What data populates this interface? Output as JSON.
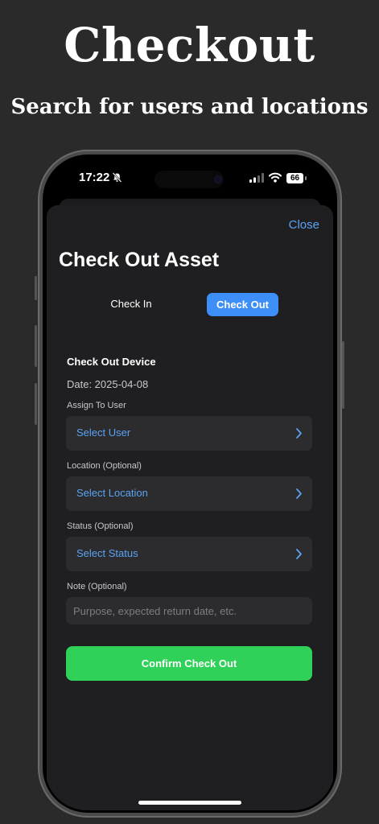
{
  "promo": {
    "title": "Checkout",
    "subtitle": "Search for users and locations"
  },
  "status_bar": {
    "time": "17:22",
    "battery": "66",
    "icons": [
      "bell-slash-icon",
      "signal-icon",
      "wifi-icon",
      "battery-icon"
    ]
  },
  "sheet": {
    "close_label": "Close",
    "title": "Check Out Asset",
    "tabs": [
      {
        "label": "Check In",
        "selected": false
      },
      {
        "label": "Check Out",
        "selected": true
      }
    ]
  },
  "form": {
    "section_title": "Check Out Device",
    "date_text": "Date: 2025-04-08",
    "fields": [
      {
        "label": "Assign To User",
        "value": "Select User"
      },
      {
        "label": "Location (Optional)",
        "value": "Select Location"
      },
      {
        "label": "Status (Optional)",
        "value": "Select Status"
      }
    ],
    "note": {
      "label": "Note (Optional)",
      "placeholder": "Purpose, expected return date, etc.",
      "value": ""
    },
    "confirm_label": "Confirm Check Out"
  },
  "colors": {
    "background": "#2a2a2a",
    "sheet": "#1f1f21",
    "field": "#2c2c2f",
    "accent_blue": "#5aa3f0",
    "tab_selected": "#3e8ef7",
    "confirm_green": "#30d158"
  }
}
